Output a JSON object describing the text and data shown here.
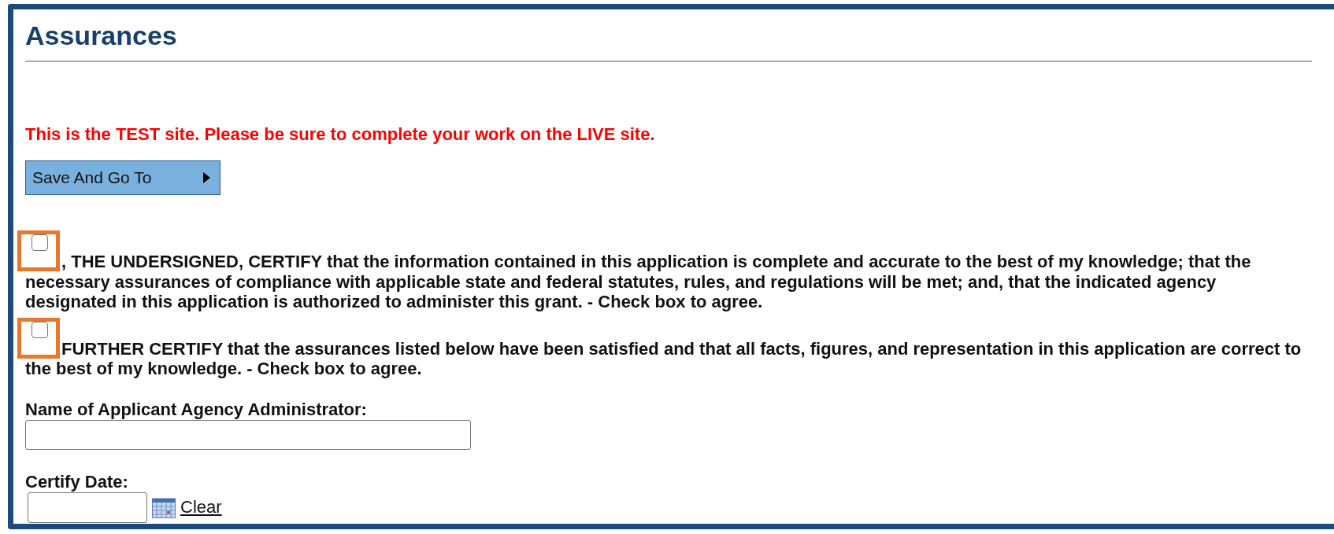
{
  "title": "Assurances",
  "notice": "This is the TEST site. Please be sure to complete your work on the LIVE site.",
  "save_button": {
    "label": "Save And Go To"
  },
  "certifications": [
    {
      "text": ", THE UNDERSIGNED, CERTIFY that the information contained in this application is complete and accurate to the best of my knowledge; that the necessary assurances of compliance with applicable state and federal statutes, rules, and regulations will be met; and, that the indicated agency designated in this application is authorized to administer this grant. - Check box to agree.",
      "checked": false,
      "highlighted": true
    },
    {
      "text": "FURTHER CERTIFY that the assurances listed below have been satisfied and that all facts, figures, and representation in this application are correct to the best of my knowledge. - Check box to agree.",
      "checked": false,
      "highlighted": true
    }
  ],
  "name_field": {
    "label": "Name of Applicant Agency Administrator:"
  },
  "date_field": {
    "label": "Certify Date:",
    "clear_link": "Clear"
  }
}
